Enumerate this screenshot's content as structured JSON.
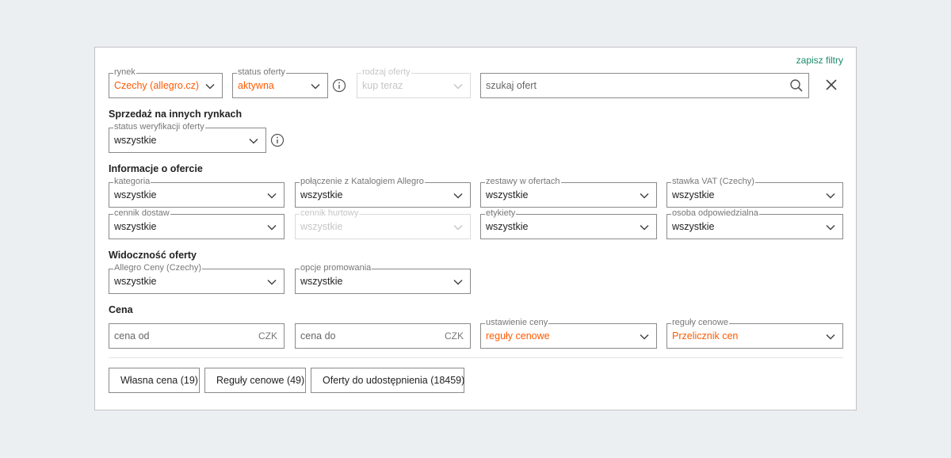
{
  "header": {
    "save_filters": "zapisz filtry"
  },
  "top_row": {
    "market": {
      "label": "rynek",
      "value": "Czechy (allegro.cz)"
    },
    "offer_status": {
      "label": "status oferty",
      "value": "aktywna"
    },
    "offer_type": {
      "label": "rodzaj oferty",
      "value": "kup teraz"
    },
    "search": {
      "placeholder": "szukaj ofert"
    }
  },
  "other_markets": {
    "title": "Sprzedaż na innych rynkach",
    "verification_status": {
      "label": "status weryfikacji oferty",
      "value": "wszystkie"
    }
  },
  "offer_info": {
    "title": "Informacje o ofercie",
    "category": {
      "label": "kategoria",
      "value": "wszystkie"
    },
    "catalog_link": {
      "label": "połączenie z Katalogiem Allegro",
      "value": "wszystkie"
    },
    "bundles": {
      "label": "zestawy w ofertach",
      "value": "wszystkie"
    },
    "vat_rate": {
      "label": "stawka VAT (Czechy)",
      "value": "wszystkie"
    },
    "delivery_pricelist": {
      "label": "cennik dostaw",
      "value": "wszystkie"
    },
    "wholesale_pricelist": {
      "label": "cennik hurtowy",
      "value": "wszystkie"
    },
    "tags": {
      "label": "etykiety",
      "value": "wszystkie"
    },
    "responsible_person": {
      "label": "osoba odpowiedzialna",
      "value": "wszystkie"
    }
  },
  "visibility": {
    "title": "Widoczność oferty",
    "allegro_prices": {
      "label": "Allegro Ceny (Czechy)",
      "value": "wszystkie"
    },
    "promotion_options": {
      "label": "opcje promowania",
      "value": "wszystkie"
    }
  },
  "price": {
    "title": "Cena",
    "price_from": {
      "placeholder": "cena od",
      "currency": "CZK"
    },
    "price_to": {
      "placeholder": "cena do",
      "currency": "CZK"
    },
    "price_setting": {
      "label": "ustawienie ceny",
      "value": "reguły cenowe"
    },
    "pricing_rules": {
      "label": "reguły cenowe",
      "value": "Przelicznik cen"
    }
  },
  "buttons": {
    "own_price": "Własna cena (19)",
    "pricing_rules": "Reguły cenowe (49)",
    "offers_to_share": "Oferty do udostępnienia (18459)"
  },
  "colors": {
    "accent": "#ff5a00",
    "link": "#1a8a6c"
  },
  "icons": {
    "dropdown": "chevron-down-icon",
    "info": "info-icon",
    "search": "search-icon",
    "clear": "close-icon"
  }
}
